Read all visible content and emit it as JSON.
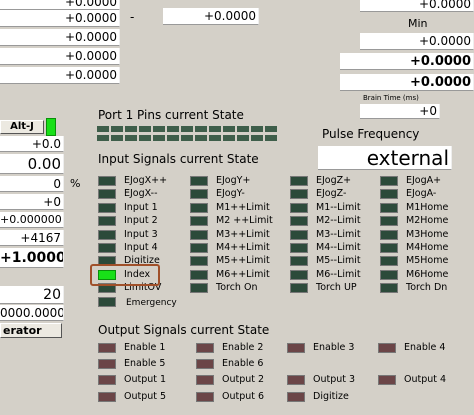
{
  "left_column": {
    "top_values": [
      "+0.0000",
      "+0.0000",
      "+0.0000",
      "+0.0000",
      "+0.0000"
    ],
    "alt_button": "Alt-J",
    "values": [
      "+0.0",
      "0.00",
      "0",
      "+0",
      "+0.000000",
      "+4167",
      "+1.0000",
      "20",
      "0000.0000"
    ],
    "percent": "%",
    "bottom_button": "erator"
  },
  "middle": {
    "dash": "-",
    "value": "+0.0000"
  },
  "right": {
    "value1": "+0.0000",
    "min_label": "Min",
    "value2": "+0.0000",
    "value3": "+0.0000",
    "value4": "+0.0000",
    "brain_time_label": "Brain Time (ms)",
    "brain_value": "+0",
    "pulse_label": "Pulse Frequency",
    "pulse_value": "external"
  },
  "port": {
    "title": "Port 1 Pins current State",
    "pin_states": [
      0,
      0,
      0,
      0,
      0,
      0,
      0,
      0,
      0,
      0,
      0,
      0,
      0,
      0,
      0,
      0,
      0,
      0,
      0,
      0,
      0,
      0,
      0,
      0,
      0,
      0
    ]
  },
  "input_signals": {
    "title": "Input Signals current State",
    "columns": [
      [
        {
          "label": "EJogX++",
          "active": false
        },
        {
          "label": "EJogX--",
          "active": false
        },
        {
          "label": "Input 1",
          "active": false
        },
        {
          "label": "Input 2",
          "active": false
        },
        {
          "label": "Input 3",
          "active": false
        },
        {
          "label": "Input 4",
          "active": false
        },
        {
          "label": "Digitize",
          "active": false
        },
        {
          "label": "Index",
          "active": true
        },
        {
          "label": "LimitOV",
          "active": false
        },
        {
          "label": "Emergency",
          "active": false
        }
      ],
      [
        {
          "label": "EJogY+",
          "active": false
        },
        {
          "label": "EJogY-",
          "active": false
        },
        {
          "label": "M1++Limit",
          "active": false
        },
        {
          "label": "M2 ++Limit",
          "active": false
        },
        {
          "label": "M3++Limit",
          "active": false
        },
        {
          "label": "M4++Limit",
          "active": false
        },
        {
          "label": "M5++Limit",
          "active": false
        },
        {
          "label": "M6++Limit",
          "active": false
        },
        {
          "label": "Torch On",
          "active": false
        }
      ],
      [
        {
          "label": "EJogZ+",
          "active": false
        },
        {
          "label": "EJogZ-",
          "active": false
        },
        {
          "label": "M1--Limit",
          "active": false
        },
        {
          "label": "M2--Limit",
          "active": false
        },
        {
          "label": "M3--Limit",
          "active": false
        },
        {
          "label": "M4--Limit",
          "active": false
        },
        {
          "label": "M5--Limit",
          "active": false
        },
        {
          "label": "M6--Limit",
          "active": false
        },
        {
          "label": "Torch UP",
          "active": false
        }
      ],
      [
        {
          "label": "EJogA+",
          "active": false
        },
        {
          "label": "EJogA-",
          "active": false
        },
        {
          "label": "M1Home",
          "active": false
        },
        {
          "label": "M2Home",
          "active": false
        },
        {
          "label": "M3Home",
          "active": false
        },
        {
          "label": "M4Home",
          "active": false
        },
        {
          "label": "M5Home",
          "active": false
        },
        {
          "label": "M6Home",
          "active": false
        },
        {
          "label": "Torch Dn",
          "active": false
        }
      ]
    ]
  },
  "output_signals": {
    "title": "Output Signals current State",
    "items": [
      {
        "label": "Enable 1"
      },
      {
        "label": "Enable 2"
      },
      {
        "label": "Enable 3"
      },
      {
        "label": "Enable 4"
      },
      {
        "label": "Enable 5"
      },
      {
        "label": "Enable 6"
      },
      {
        "label": "Output 1"
      },
      {
        "label": "Output 2"
      },
      {
        "label": "Output 3"
      },
      {
        "label": "Output 4"
      },
      {
        "label": "Output 5"
      },
      {
        "label": "Output 6"
      },
      {
        "label": "Digitize"
      }
    ]
  },
  "colors": {
    "background": "#d4d0c8",
    "led_off_input": "#2c4a3a",
    "led_off_output": "#6b4547",
    "led_on": "#18e018",
    "highlight": "#a0502a"
  }
}
